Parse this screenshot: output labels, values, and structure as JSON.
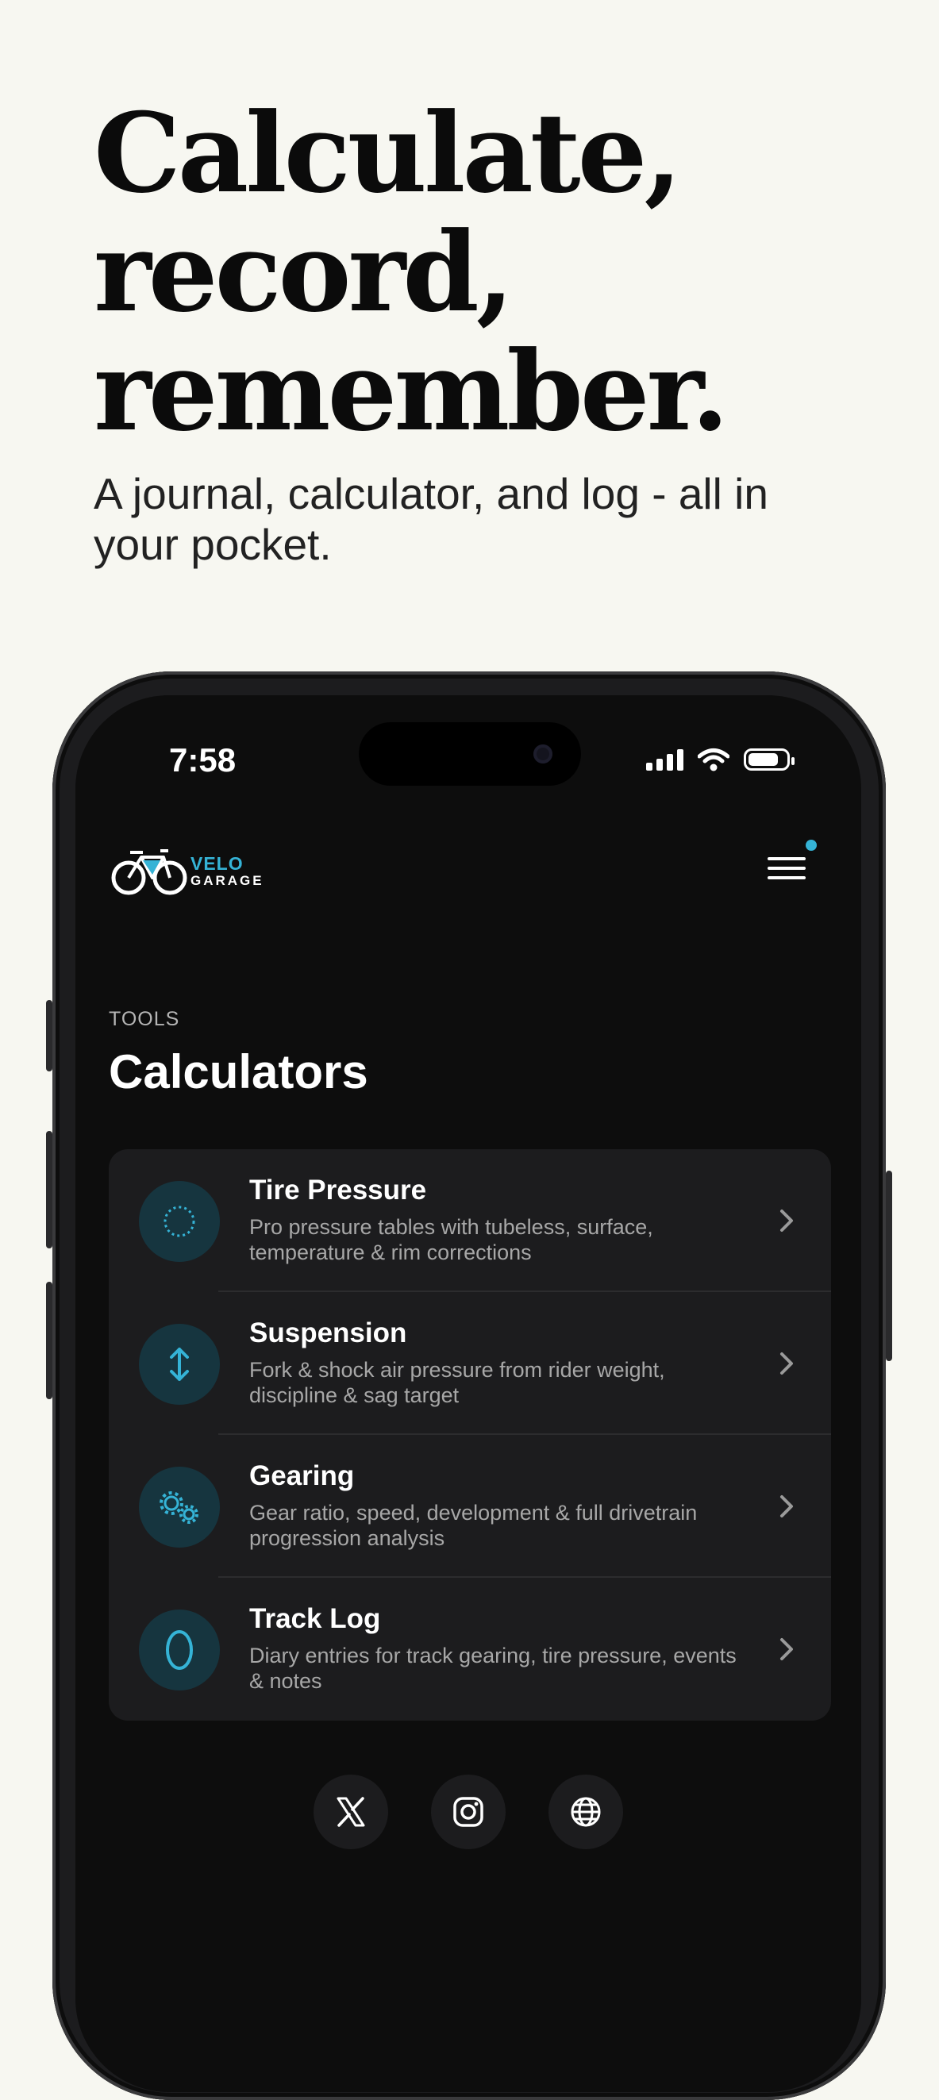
{
  "hero": {
    "headline_lines": [
      "Calculate,",
      "record,",
      "remember."
    ],
    "subheadline": "A journal, calculator, and log - all in your pocket."
  },
  "status_bar": {
    "time": "7:58"
  },
  "app": {
    "logo": {
      "brand_top": "VELO",
      "brand_bottom": "GARAGE"
    },
    "menu_icon": "hamburger-menu-icon",
    "section_label": "TOOLS",
    "page_title": "Calculators",
    "accent_color": "#35b3d6",
    "tools": [
      {
        "icon": "dotted-circle-icon",
        "label": "Tire Pressure",
        "description": "Pro pressure tables with tubeless, surface, temperature & rim corrections"
      },
      {
        "icon": "vertical-arrows-icon",
        "label": "Suspension",
        "description": "Fork & shock air pressure from rider weight, discipline & sag target"
      },
      {
        "icon": "gears-icon",
        "label": "Gearing",
        "description": "Gear ratio, speed, development & full drivetrain progression analysis"
      },
      {
        "icon": "oval-track-icon",
        "label": "Track Log",
        "description": "Diary entries for track gearing, tire pressure, events & notes"
      }
    ],
    "socials": [
      "x-icon",
      "instagram-icon",
      "globe-icon"
    ]
  }
}
